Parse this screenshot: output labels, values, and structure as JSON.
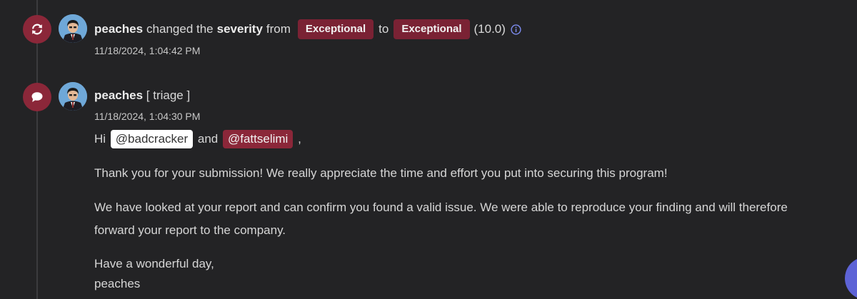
{
  "event1": {
    "icon": "refresh-icon",
    "user": "peaches",
    "text_changed": "changed the",
    "field": "severity",
    "text_from": "from",
    "from_value": "Exceptional",
    "text_to": "to",
    "to_value": "Exceptional",
    "score": "(10.0)",
    "info_icon": "info-icon",
    "timestamp": "11/18/2024, 1:04:42 PM"
  },
  "event2": {
    "icon": "comment-icon",
    "user": "peaches",
    "role": "[ triage ]",
    "timestamp": "11/18/2024, 1:04:30 PM",
    "greeting_prefix": "Hi",
    "mention1": "@badcracker",
    "connector": "and",
    "mention2": "@fattselimi",
    "greeting_suffix": ",",
    "para1": "Thank you for your submission! We really appreciate the time and effort you put into securing this program!",
    "para2_line1": "We have looked at your report and can confirm you found a valid issue. We were able to reproduce your finding and will therefore",
    "para2_line2": "forward your report to the company.",
    "sign_line1": "Have a wonderful day,",
    "sign_line2": "peaches"
  },
  "colors": {
    "background": "#232325",
    "accent": "#8b2739",
    "badge": "#7a2234",
    "fab": "#5d63d6"
  }
}
